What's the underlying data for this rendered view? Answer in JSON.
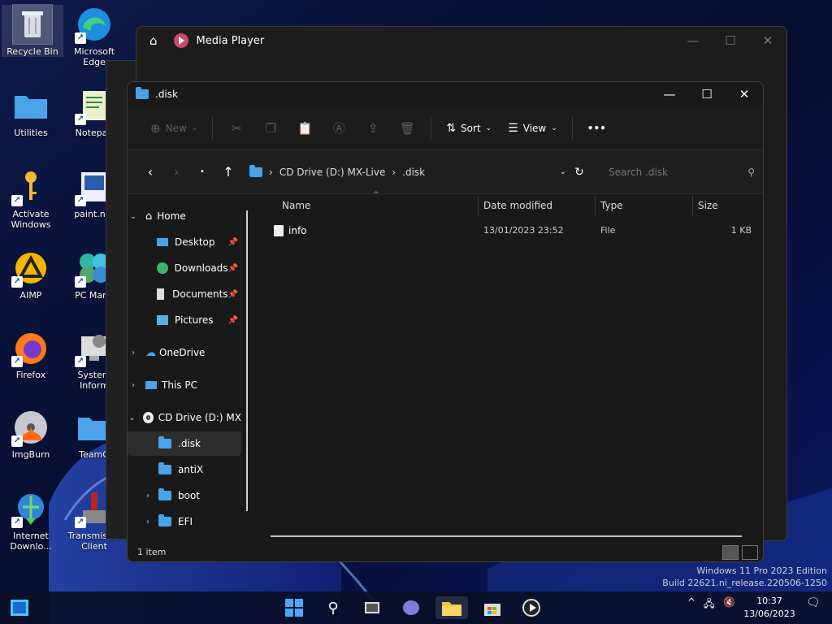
{
  "desktop": {
    "icons": [
      {
        "label": "Recycle Bin",
        "name": "recycle-bin"
      },
      {
        "label": "Microsoft Edge",
        "name": "microsoft-edge"
      },
      {
        "label": "Utilities",
        "name": "utilities"
      },
      {
        "label": "Notepad",
        "name": "notepad"
      },
      {
        "label": "Activate Windows",
        "name": "activate-windows"
      },
      {
        "label": "paint.net",
        "name": "paint-net"
      },
      {
        "label": "AIMP",
        "name": "aimp"
      },
      {
        "label": "PC Mana",
        "name": "pc-manager"
      },
      {
        "label": "Firefox",
        "name": "firefox"
      },
      {
        "label": "System Inform",
        "name": "system-information"
      },
      {
        "label": "ImgBurn",
        "name": "imgburn"
      },
      {
        "label": "TeamO",
        "name": "teamviewer"
      },
      {
        "label": "Internet Downlo...",
        "name": "internet-download-manager"
      },
      {
        "label": "Transmis Qt Client",
        "name": "transmission-qt"
      }
    ]
  },
  "media_player": {
    "title": "Media Player",
    "minimize": "—",
    "maximize": "☐",
    "close": "✕"
  },
  "explorer": {
    "title": ".disk",
    "minimize": "—",
    "maximize": "☐",
    "close": "✕",
    "toolbar": {
      "new_label": "New",
      "sort_label": "Sort",
      "view_label": "View",
      "more_label": "•••"
    },
    "address": {
      "segments": [
        "CD Drive (D:) MX-Live",
        ".disk"
      ],
      "separator": "›"
    },
    "search": {
      "placeholder": "Search .disk"
    },
    "sidebar": {
      "home": "Home",
      "desktop": "Desktop",
      "downloads": "Downloads",
      "documents": "Documents",
      "pictures": "Pictures",
      "onedrive": "OneDrive",
      "thispc": "This PC",
      "cddrive": "CD Drive (D:) MX",
      "disk": ".disk",
      "antix": "antiX",
      "boot": "boot",
      "efi": "EFI"
    },
    "columns": {
      "name": "Name",
      "date": "Date modified",
      "type": "Type",
      "size": "Size"
    },
    "files": [
      {
        "name": "info",
        "date": "13/01/2023 23:52",
        "type": "File",
        "size": "1 KB"
      }
    ],
    "status": "1 item"
  },
  "watermark": {
    "line1": "Windows 11 Pro 2023 Edition",
    "line2": "Build 22621.ni_release.220506-1250"
  },
  "taskbar": {
    "time": "10:37",
    "date": "13/06/2023"
  },
  "colors": {
    "accent": "#4aa3e8",
    "window_bg": "#191919",
    "taskbar_bg": "#0a1028"
  }
}
